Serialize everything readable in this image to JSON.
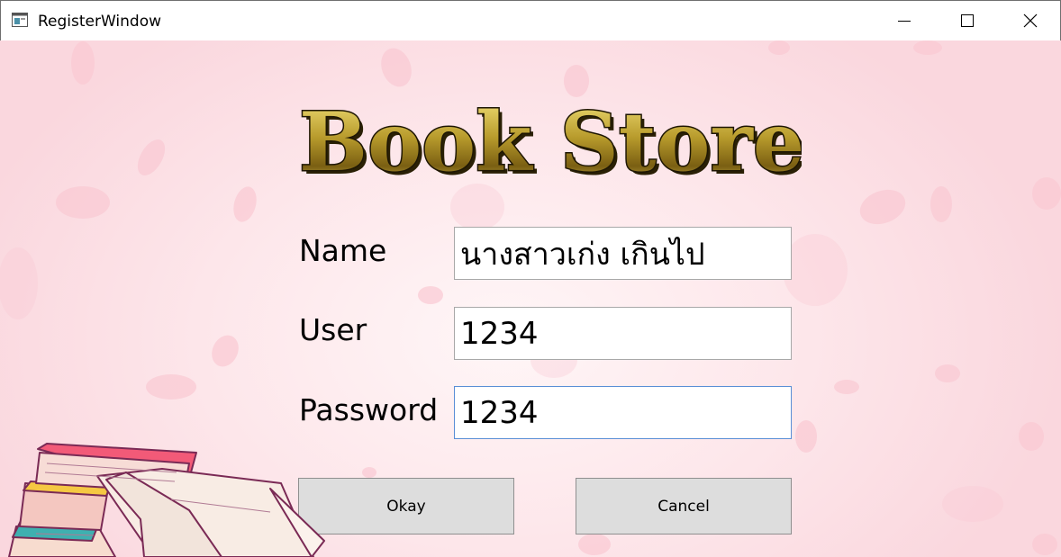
{
  "window": {
    "title": "RegisterWindow",
    "controls": [
      "minimize-icon",
      "maximize-icon",
      "close-icon"
    ]
  },
  "logo": {
    "text": "Book Store"
  },
  "form": {
    "name_label": "Name",
    "name_value": "นางสาวเก่ง เกินไป",
    "user_label": "User",
    "user_value": "1234",
    "password_label": "Password",
    "password_value": "1234",
    "focused_field": "password"
  },
  "buttons": {
    "okay_label": "Okay",
    "cancel_label": "Cancel"
  },
  "colors": {
    "background": "#fde6ea",
    "petal": "#f9c9d3",
    "logo_gold": "#b8a13a",
    "button_face": "#dddddd",
    "focus_border": "#5a8fd6"
  },
  "decoration": {
    "illustration": "books-illustration-icon"
  }
}
